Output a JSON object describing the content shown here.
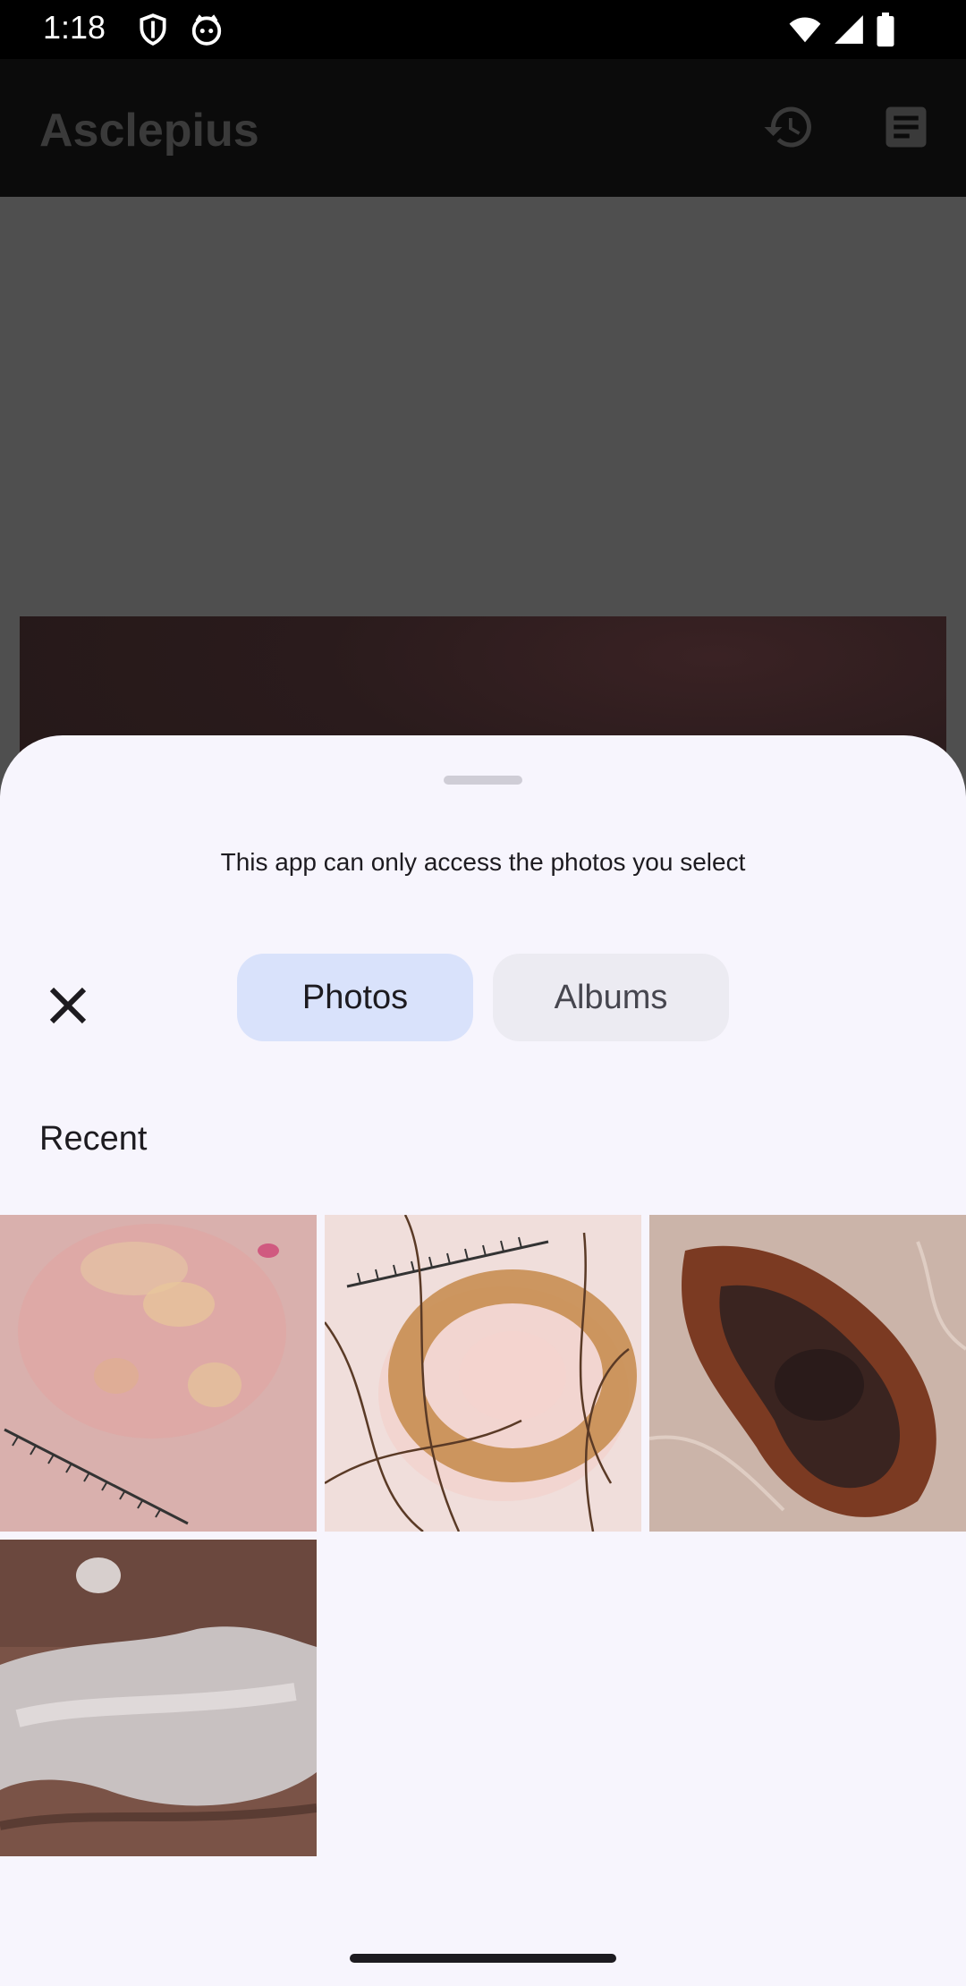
{
  "status_bar": {
    "time": "1:18",
    "icons": [
      "shield-icon",
      "cat-face-icon",
      "wifi-icon",
      "signal-icon",
      "battery-icon"
    ]
  },
  "app_bar": {
    "title": "Asclepius",
    "icons": [
      "history-icon",
      "notes-icon"
    ]
  },
  "sheet": {
    "message": "This app can only access the photos you select",
    "tabs": [
      {
        "label": "Photos",
        "selected": true
      },
      {
        "label": "Albums",
        "selected": false
      }
    ],
    "section_label": "Recent",
    "photos": [
      {
        "name": "skin-lesion-photo-1"
      },
      {
        "name": "skin-lesion-photo-2"
      },
      {
        "name": "skin-lesion-photo-3"
      },
      {
        "name": "skin-lesion-photo-4"
      }
    ]
  },
  "colors": {
    "sheet_bg": "#f7f5fd",
    "selected_tab": "#d9e2fb",
    "unselected_tab": "#ecebf2"
  }
}
